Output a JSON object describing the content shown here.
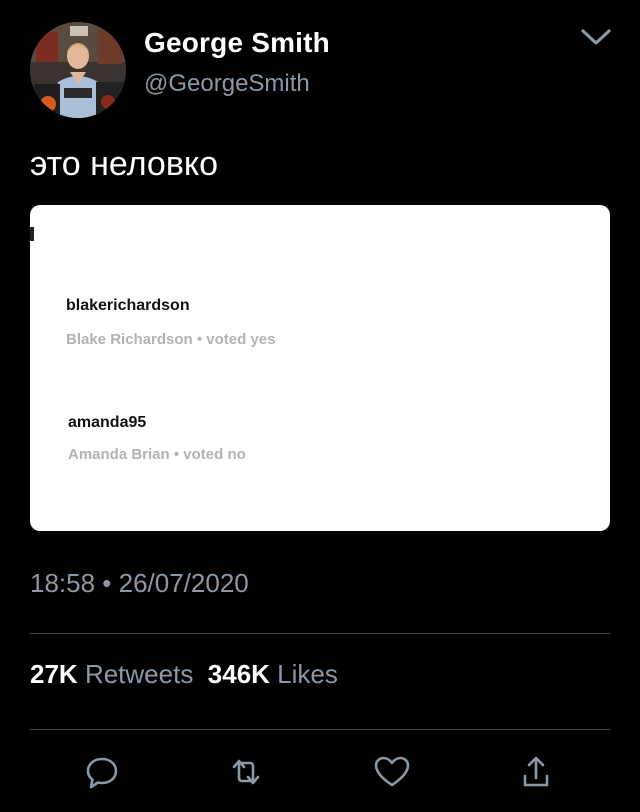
{
  "tweet": {
    "author": {
      "display_name": "George Smith",
      "handle": "@GeorgeSmith"
    },
    "text": "это неловко",
    "media": {
      "votes": [
        {
          "username": "blakerichardson",
          "meta": "Blake Richardson • voted yes"
        },
        {
          "username": "amanda95",
          "meta": "Amanda Brian • voted no"
        }
      ]
    },
    "timestamp": "18:58 • 26/07/2020",
    "stats": {
      "retweets_count": "27K",
      "retweets_label": "Retweets",
      "likes_count": "346K",
      "likes_label": "Likes"
    },
    "actions": [
      "reply-icon",
      "retweet-icon",
      "like-icon",
      "share-icon"
    ]
  },
  "colors": {
    "background": "#000000",
    "text": "#ffffff",
    "secondary_text": "#8b98a5",
    "divider": "#38444d"
  }
}
